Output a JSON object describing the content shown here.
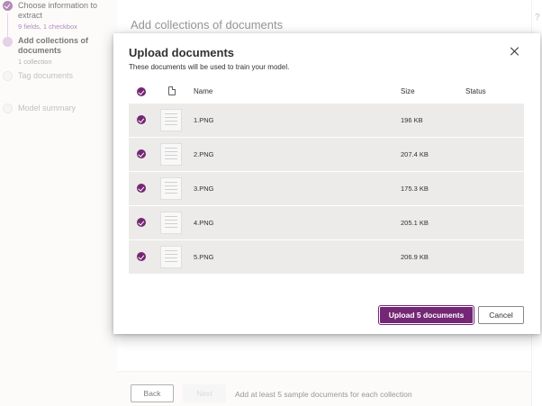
{
  "stepper": {
    "steps": [
      {
        "title": "Choose information to extract",
        "subtitle": "9 fields, 1 checkbox",
        "state": "done"
      },
      {
        "title": "Add collections of documents",
        "subtitle": "1 collection",
        "state": "current"
      },
      {
        "title": "Tag documents",
        "subtitle": "",
        "state": "future"
      },
      {
        "title": "Model summary",
        "subtitle": "",
        "state": "future"
      }
    ]
  },
  "main": {
    "title": "Add collections of documents",
    "back_label": "Back",
    "next_label": "Next",
    "hint": "Add at least 5 sample documents for each collection"
  },
  "dialog": {
    "title": "Upload documents",
    "subtitle": "These documents will be used to train your model.",
    "columns": {
      "name": "Name",
      "size": "Size",
      "status": "Status"
    },
    "rows": [
      {
        "name": "1.PNG",
        "size": "196 KB",
        "status": ""
      },
      {
        "name": "2.PNG",
        "size": "207.4 KB",
        "status": ""
      },
      {
        "name": "3.PNG",
        "size": "175.3 KB",
        "status": ""
      },
      {
        "name": "4.PNG",
        "size": "205.1 KB",
        "status": ""
      },
      {
        "name": "5.PNG",
        "size": "206.9 KB",
        "status": ""
      }
    ],
    "upload_label": "Upload 5 documents",
    "cancel_label": "Cancel"
  },
  "theme": {
    "accent": "#742774",
    "step_done": "#8a4b8f",
    "step_current": "#d7b8dc",
    "row_bg": "#edebe9"
  },
  "icons": {
    "close": "close-icon",
    "file": "file-icon",
    "check": "checkmark-circle-icon",
    "help": "help-icon"
  }
}
